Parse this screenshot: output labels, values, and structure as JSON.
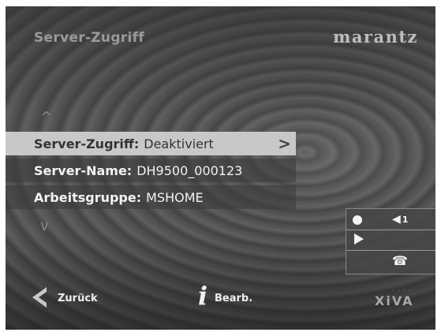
{
  "header": {
    "title": "Server-Zugriff",
    "brand": "marantz"
  },
  "settings": [
    {
      "label": "Server-Zugriff:",
      "value": "Deaktiviert",
      "selected": true
    },
    {
      "label": "Server-Name:",
      "value": "DH9500_000123",
      "selected": false
    },
    {
      "label": "Arbeitsgruppe:",
      "value": "MSHOME",
      "selected": false
    }
  ],
  "scroll": {
    "up_glyph": "^",
    "down_glyph": "v"
  },
  "status": {
    "volume_level": "1"
  },
  "footer": {
    "back_label": "Zurück",
    "edit_label": "Bearb.",
    "info_glyph": "i",
    "logo_text": "XiVA"
  },
  "icons": [
    "chevron-up-icon",
    "chevron-down-icon",
    "chevron-right-icon",
    "record-icon",
    "speaker-icon",
    "play-icon",
    "phone-icon",
    "back-chevron-icon",
    "info-icon"
  ],
  "colors": {
    "selected_row_bg": "#c8c8c8",
    "selected_row_text": "#333333",
    "row_text": "#f2f2f2",
    "background": "#505050"
  }
}
